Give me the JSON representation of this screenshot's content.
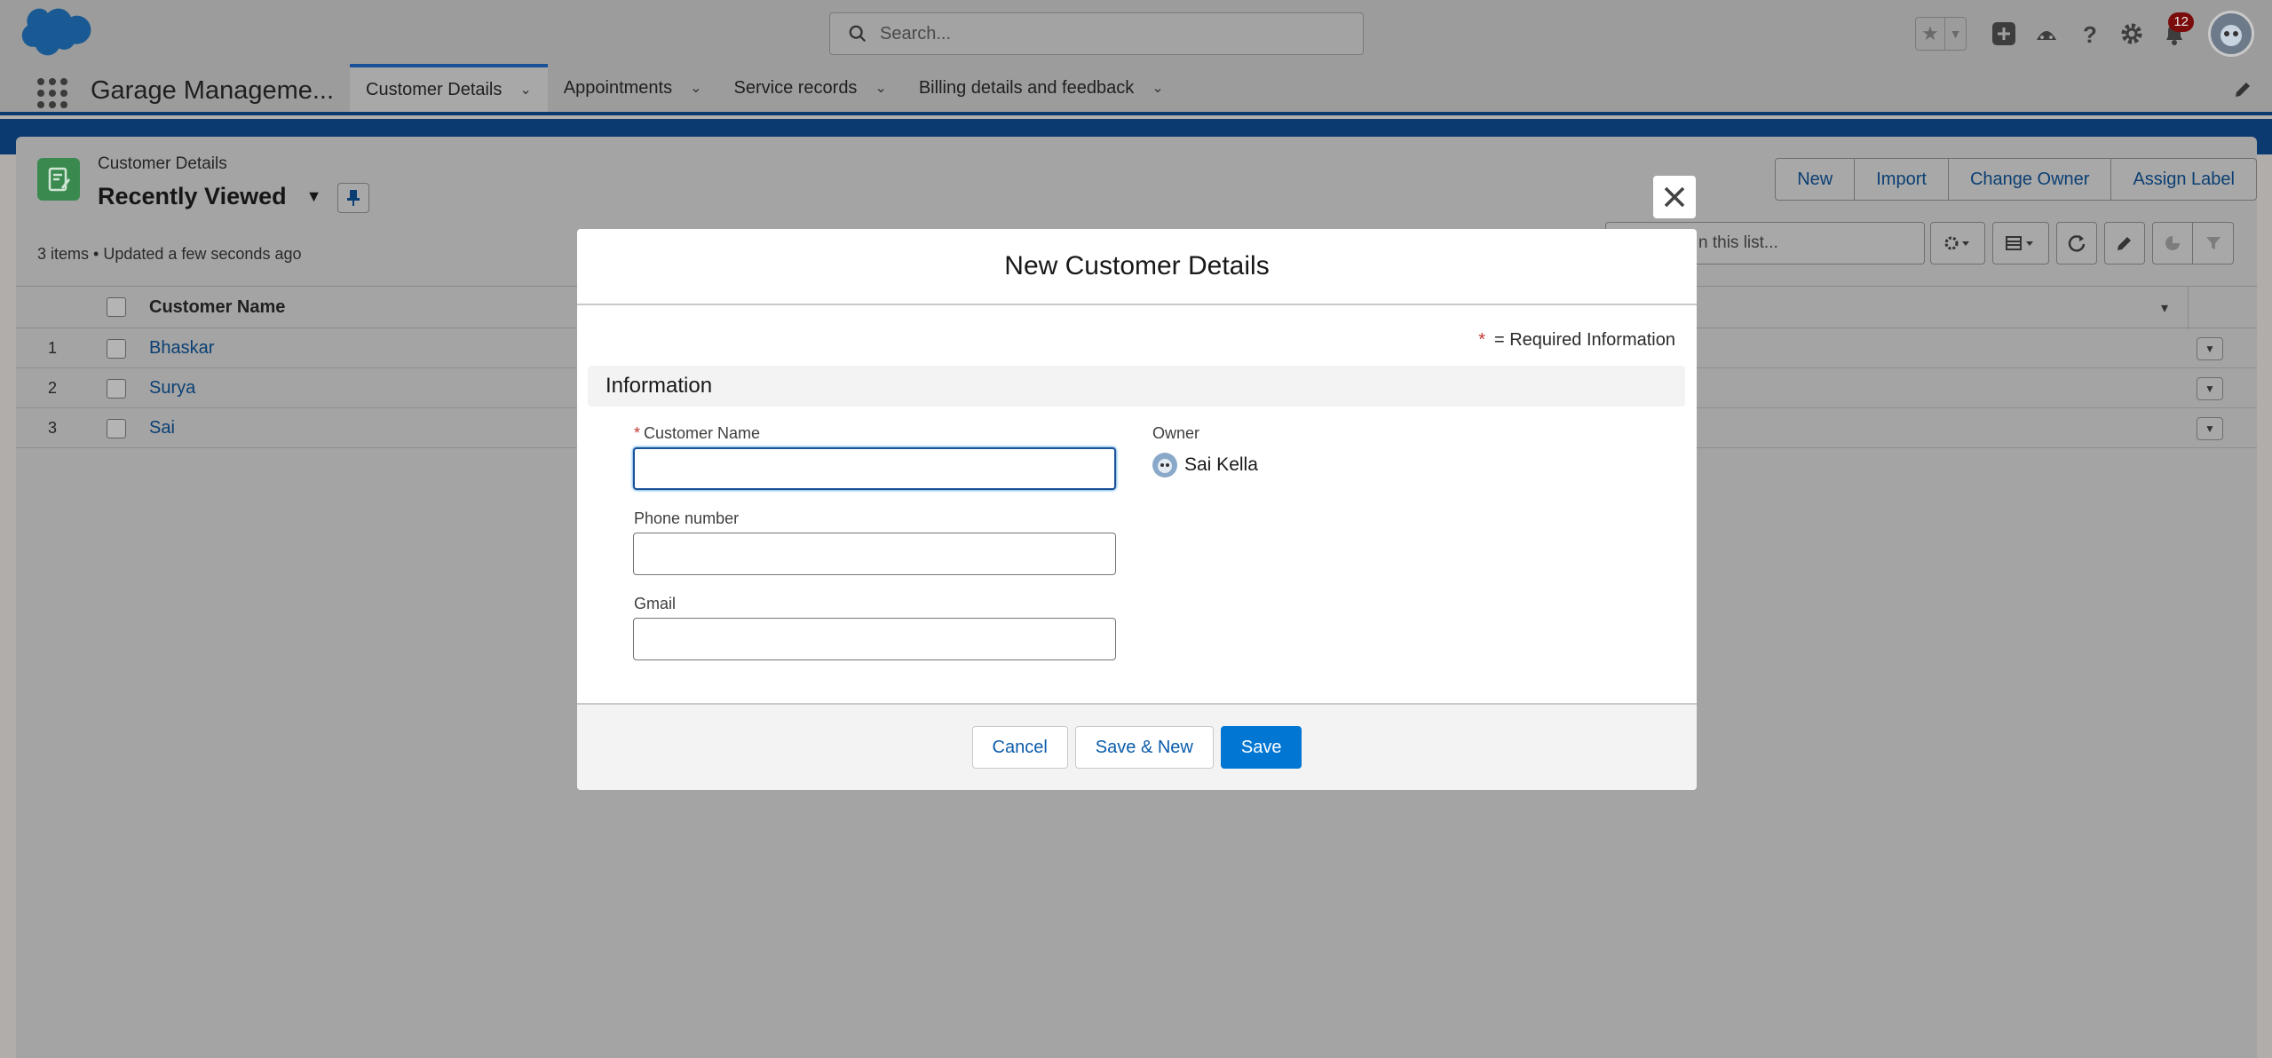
{
  "global_header": {
    "search_placeholder": "Search...",
    "notification_count": "12"
  },
  "nav": {
    "app_name": "Garage Manageme...",
    "tabs": [
      {
        "label": "Customer Details",
        "active": true
      },
      {
        "label": "Appointments",
        "active": false
      },
      {
        "label": "Service records",
        "active": false
      },
      {
        "label": "Billing details and feedback",
        "active": false
      }
    ]
  },
  "list_view": {
    "object_label": "Customer Details",
    "title": "Recently Viewed",
    "meta": "3 items • Updated a few seconds ago",
    "actions": [
      "New",
      "Import",
      "Change Owner",
      "Assign Label"
    ],
    "search_placeholder": "n this list...",
    "column_header": "Customer Name",
    "rows": [
      {
        "num": "1",
        "name": "Bhaskar"
      },
      {
        "num": "2",
        "name": "Surya"
      },
      {
        "num": "3",
        "name": "Sai"
      }
    ]
  },
  "modal": {
    "title": "New Customer Details",
    "required_note": "= Required Information",
    "required_star": "*",
    "section": "Information",
    "fields": {
      "customer_name": {
        "label": "Customer Name",
        "value": ""
      },
      "phone": {
        "label": "Phone number",
        "value": ""
      },
      "gmail": {
        "label": "Gmail",
        "value": ""
      },
      "owner": {
        "label": "Owner",
        "value": "Sai Kella"
      }
    },
    "buttons": {
      "cancel": "Cancel",
      "save_new": "Save & New",
      "save": "Save"
    }
  },
  "colors": {
    "brand": "#0176d3",
    "required": "#c23934",
    "link": "#0b5cab"
  }
}
